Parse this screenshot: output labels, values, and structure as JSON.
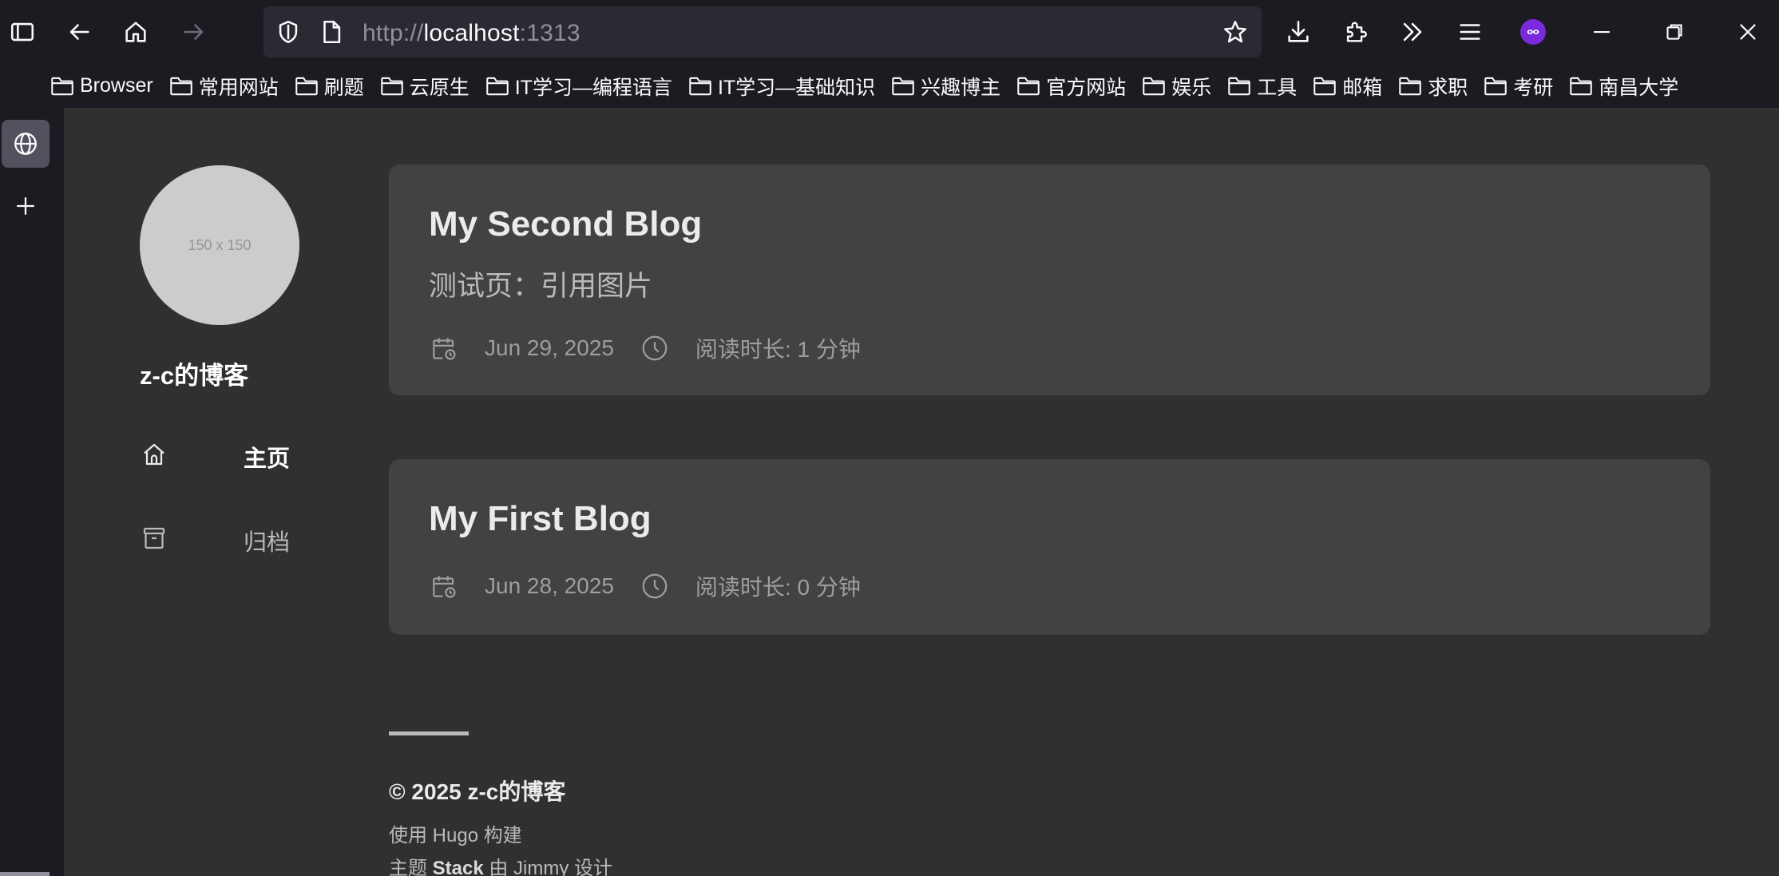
{
  "browser": {
    "url_scheme": "http://",
    "url_host": "localhost",
    "url_port": ":1313",
    "bookmarks": [
      {
        "label": "Browser"
      },
      {
        "label": "常用网站"
      },
      {
        "label": "刷题"
      },
      {
        "label": "云原生"
      },
      {
        "label": "IT学习—编程语言"
      },
      {
        "label": "IT学习—基础知识"
      },
      {
        "label": "兴趣博主"
      },
      {
        "label": "官方网站"
      },
      {
        "label": "娱乐"
      },
      {
        "label": "工具"
      },
      {
        "label": "邮箱"
      },
      {
        "label": "求职"
      },
      {
        "label": "考研"
      },
      {
        "label": "南昌大学"
      }
    ],
    "icons": {
      "sidebar_toggle": "sidebar-icon",
      "back": "arrow-left-icon",
      "home": "home-icon",
      "forward": "arrow-right-icon",
      "shield": "shield-icon",
      "page": "page-icon",
      "star": "star-icon",
      "download": "download-icon",
      "extensions": "puzzle-icon",
      "overflow": "chevron-double-right-icon",
      "menu": "hamburger-icon",
      "profile": "private-mask-icon",
      "minimize": "minimize-icon",
      "restore": "restore-icon",
      "close": "close-icon"
    },
    "profile_color": "#7a29db"
  },
  "site": {
    "avatar_placeholder": "150 x 150",
    "name": "z-c的博客",
    "menu": [
      {
        "label": "主页",
        "icon": "home-icon",
        "active": true
      },
      {
        "label": "归档",
        "icon": "archive-icon",
        "active": false
      }
    ]
  },
  "posts": [
    {
      "title": "My Second Blog",
      "subtitle": "测试页：引用图片",
      "date": "Jun 29, 2025",
      "reading_time": "阅读时长: 1 分钟"
    },
    {
      "title": "My First Blog",
      "subtitle": "",
      "date": "Jun 28, 2025",
      "reading_time": "阅读时长: 0 分钟"
    }
  ],
  "footer": {
    "copyright": "© 2025 z-c的博客",
    "built_prefix": "使用 Hugo 构建",
    "theme_prefix": "主题",
    "theme_name": "Stack",
    "theme_by": "由 Jimmy 设计"
  },
  "colors": {
    "page_bg": "#303030",
    "card_bg": "#424242",
    "chrome_bg": "#1c1b22"
  }
}
